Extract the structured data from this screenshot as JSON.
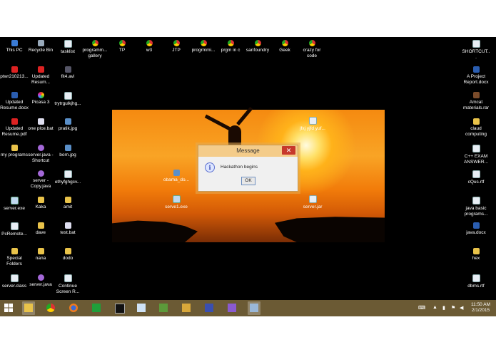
{
  "desktop": {
    "left_icons": [
      {
        "label": "This PC",
        "icon": "pc-icon"
      },
      {
        "label": "Recycle Bin",
        "icon": "recycle-bin-icon"
      },
      {
        "label": "tasklist",
        "icon": "file-icon"
      },
      {
        "label": "programm... gallery",
        "icon": "chrome-icon"
      },
      {
        "label": "TP",
        "icon": "chrome-icon"
      },
      {
        "label": "w3",
        "icon": "chrome-icon"
      },
      {
        "label": "JTP",
        "icon": "chrome-icon"
      },
      {
        "label": "progrmmi...",
        "icon": "chrome-icon"
      },
      {
        "label": "prgm in c",
        "icon": "chrome-icon"
      },
      {
        "label": "sanfoundry",
        "icon": "chrome-icon"
      },
      {
        "label": "Geek",
        "icon": "chrome-icon"
      },
      {
        "label": "crazy for code",
        "icon": "chrome-icon"
      },
      {
        "label": "ptwr210213...",
        "icon": "pdf-icon"
      },
      {
        "label": "Updated Resum...",
        "icon": "pdf-icon"
      },
      {
        "label": "fit4.avi",
        "icon": "video-icon"
      },
      {
        "label": "Updated Resume.docx",
        "icon": "word-icon"
      },
      {
        "label": "Picasa 3",
        "icon": "picasa-icon"
      },
      {
        "label": "trytrgulkjhg...",
        "icon": "file-icon"
      },
      {
        "label": "Updated Resume.pdf",
        "icon": "pdf-icon"
      },
      {
        "label": "one plce.bat",
        "icon": "bat-icon"
      },
      {
        "label": "pratik.jpg",
        "icon": "image-icon"
      },
      {
        "label": "my programs",
        "icon": "folder-icon"
      },
      {
        "label": "server.java - Shortcut",
        "icon": "java-icon"
      },
      {
        "label": "born.jpg",
        "icon": "image-icon"
      },
      {
        "label": "server - Copy.java",
        "icon": "java-icon"
      },
      {
        "label": "ethyfghgcv...",
        "icon": "file-icon"
      },
      {
        "label": "server.exe",
        "icon": "exe-icon"
      },
      {
        "label": "Kaka",
        "icon": "folder-icon"
      },
      {
        "label": "amit",
        "icon": "folder-icon"
      },
      {
        "label": "PcRemote...",
        "icon": "file-icon"
      },
      {
        "label": "dave",
        "icon": "folder-icon"
      },
      {
        "label": "test.bat",
        "icon": "bat-icon"
      },
      {
        "label": "Special Folders",
        "icon": "folder-icon"
      },
      {
        "label": "nana",
        "icon": "folder-icon"
      },
      {
        "label": "dodo",
        "icon": "folder-icon"
      },
      {
        "label": "server.class",
        "icon": "file-icon"
      },
      {
        "label": "server.java",
        "icon": "java-icon"
      },
      {
        "label": "Continue Screen R...",
        "icon": "file-icon"
      }
    ],
    "right_icons": [
      {
        "label": "SHORTCUT...",
        "icon": "file-icon"
      },
      {
        "label": "A Project Report.docx",
        "icon": "word-icon"
      },
      {
        "label": "Amcat materials.rar",
        "icon": "rar-icon"
      },
      {
        "label": "claud computing",
        "icon": "folder-icon"
      },
      {
        "label": "C++ EXAM ANSWER...",
        "icon": "file-icon"
      },
      {
        "label": "cQus.rtf",
        "icon": "file-icon"
      },
      {
        "label": "java basic programs...",
        "icon": "file-icon"
      },
      {
        "label": "java.docx",
        "icon": "word-icon"
      },
      {
        "label": "hex",
        "icon": "folder-icon"
      },
      {
        "label": "dbms.rtf",
        "icon": "file-icon"
      }
    ],
    "wallpaper_icons": [
      {
        "label": "jfxj yjfd yuf...",
        "icon": "file-icon"
      },
      {
        "label": "obama_do...",
        "icon": "image-icon"
      },
      {
        "label": "serve1.exe",
        "icon": "exe-icon"
      },
      {
        "label": "server.jar",
        "icon": "file-icon"
      }
    ]
  },
  "dialog": {
    "title": "Message",
    "close_glyph": "✕",
    "info_glyph": "i",
    "message": "Hackathon begins",
    "ok_label": "OK"
  },
  "taskbar": {
    "apps": [
      "windows-start-icon",
      "file-explorer-icon",
      "chrome-icon",
      "firefox-icon",
      "store-icon",
      "cmd-icon",
      "notepad-icon",
      "image-viewer-icon",
      "word-icon",
      "java-icon",
      "visual-studio-icon",
      "remote-desktop-icon"
    ],
    "time": "11:50 AM",
    "date": "2/1/2015"
  },
  "colors": {
    "taskbar": "#6b5a34",
    "dialog_title": "#f4cc8a",
    "close_button": "#c7382b"
  }
}
